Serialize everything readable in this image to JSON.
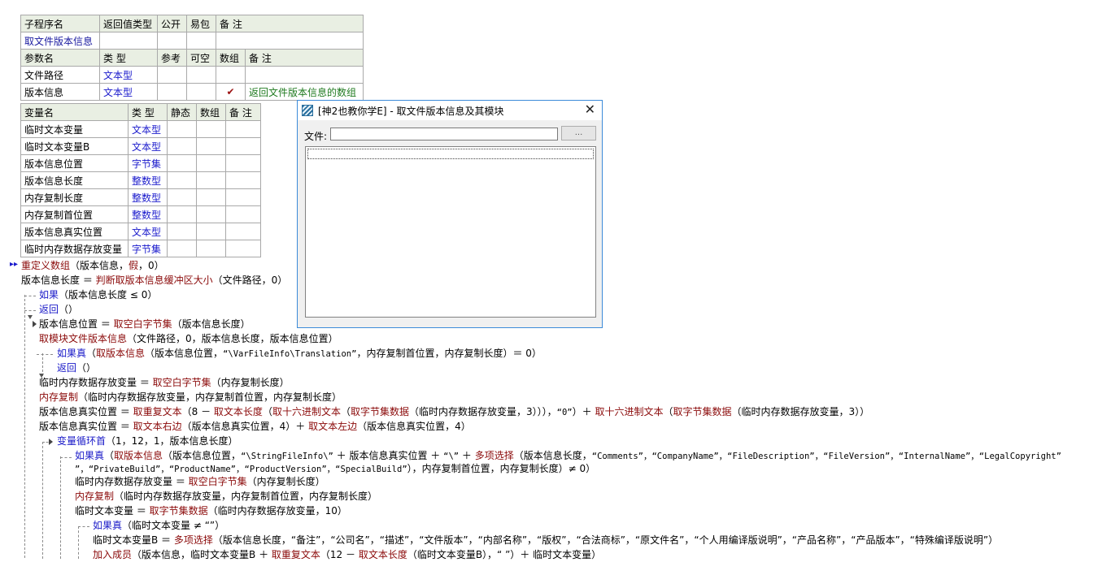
{
  "sub_table": {
    "headers": [
      "子程序名",
      "返回值类型",
      "公开",
      "易包",
      "备 注"
    ],
    "name": "取文件版本信息",
    "param_headers": [
      "参数名",
      "类 型",
      "参考",
      "可空",
      "数组",
      "备 注"
    ],
    "params": [
      {
        "name": "文件路径",
        "type": "文本型",
        "ref": "",
        "nullable": "",
        "array": "",
        "note": ""
      },
      {
        "name": "版本信息",
        "type": "文本型",
        "ref": "",
        "nullable": "",
        "array": "✔",
        "note": "返回文件版本信息的数组"
      }
    ]
  },
  "var_table": {
    "headers": [
      "变量名",
      "类 型",
      "静态",
      "数组",
      "备 注"
    ],
    "rows": [
      {
        "name": "临时文本变量",
        "type": "文本型"
      },
      {
        "name": "临时文本变量B",
        "type": "文本型"
      },
      {
        "name": "版本信息位置",
        "type": "字节集"
      },
      {
        "name": "版本信息长度",
        "type": "整数型"
      },
      {
        "name": "内存复制长度",
        "type": "整数型"
      },
      {
        "name": "内存复制首位置",
        "type": "整数型"
      },
      {
        "name": "版本信息真实位置",
        "type": "文本型"
      },
      {
        "name": "临时内存数据存放变量",
        "type": "字节集"
      }
    ]
  },
  "code": {
    "l1_cmd": "重定义数组",
    "l1_args": "（版本信息，",
    "l1_false": "假",
    "l1_end": "，0）",
    "l2_a": "版本信息长度 ＝ ",
    "l2_cmd": "判断取版本信息缓冲区大小",
    "l2_b": "（文件路径，0）",
    "l3_kw": "如果",
    "l3_b": "（版本信息长度 ≤ 0）",
    "l4_kw": "返回",
    "l4_b": "（）",
    "l5_a": "版本信息位置 ＝ ",
    "l5_cmd": "取空白字节集",
    "l5_b": "（版本信息长度）",
    "l6_cmd": "取模块文件版本信息",
    "l6_b": "（文件路径，0，版本信息长度，版本信息位置）",
    "l7_kw": "如果真",
    "l7_b": "（",
    "l7_cmd": "取版本信息",
    "l7_c": "（版本信息位置，",
    "l7_str": "“\\VarFileInfo\\Translation”",
    "l7_d": "，内存复制首位置，内存复制长度）＝ 0）",
    "l8_kw": "返回",
    "l8_b": "（）",
    "l9_a": "临时内存数据存放变量 ＝ ",
    "l9_cmd": "取空白字节集",
    "l9_b": "（内存复制长度）",
    "l10_cmd": "内存复制",
    "l10_b": "（临时内存数据存放变量，内存复制首位置，内存复制长度）",
    "l11_a": "版本信息真实位置 ＝ ",
    "l11_cmd1": "取重复文本",
    "l11_b": "（8 － ",
    "l11_cmd2": "取文本长度",
    "l11_c": "（",
    "l11_cmd3": "取十六进制文本",
    "l11_d": "（",
    "l11_cmd4": "取字节集数据",
    "l11_e": "（临时内存数据存放变量，3））），",
    "l11_str": "“0”",
    "l11_f": "）＋ ",
    "l11_cmd5": "取十六进制文本",
    "l11_g": "（",
    "l11_cmd6": "取字节集数据",
    "l11_h": "（临时内存数据存放变量，3））",
    "l12_a": "版本信息真实位置 ＝ ",
    "l12_cmd1": "取文本右边",
    "l12_b": "（版本信息真实位置，4）＋ ",
    "l12_cmd2": "取文本左边",
    "l12_c": "（版本信息真实位置，4）",
    "l13_kw": "变量循环首",
    "l13_b": "（1，12，1，版本信息长度）",
    "l14_kw": "如果真",
    "l14_b": "（",
    "l14_cmd": "取版本信息",
    "l14_c": "（版本信息位置，",
    "l14_str1": "“\\StringFileInfo\\”",
    "l14_d": " ＋ 版本信息真实位置 ＋ ",
    "l14_str2": "“\\”",
    "l14_e": " ＋ ",
    "l14_cmd2": "多项选择",
    "l14_f": "（版本信息长度，",
    "l14_str3": "“Comments”，“CompanyName”，“FileDescription”，“FileVersion”，“InternalName”，“LegalCopyright”",
    "l15_str": "”，“PrivateBuild”，“ProductName”，“ProductVersion”，“SpecialBuild”",
    "l15_b": "），内存复制首位置，内存复制长度）≠ 0）",
    "l16_a": "临时内存数据存放变量 ＝ ",
    "l16_cmd": "取空白字节集",
    "l16_b": "（内存复制长度）",
    "l17_cmd": "内存复制",
    "l17_b": "（临时内存数据存放变量，内存复制首位置，内存复制长度）",
    "l18_a": "临时文本变量 ＝ ",
    "l18_cmd": "取字节集数据",
    "l18_b": "（临时内存数据存放变量，10）",
    "l19_kw": "如果真",
    "l19_b": "（临时文本变量 ≠ “”）",
    "l20_a": "临时文本变量B ＝ ",
    "l20_cmd": "多项选择",
    "l20_b": "（版本信息长度，“备注”，“公司名”，“描述”，“文件版本”，“内部名称”，“版权”，“合法商标”，“原文件名”，“个人用编译版说明”，“产品名称”，“产品版本”，“特殊编译版说明”）",
    "l21_cmd": "加入成员",
    "l21_b": "（版本信息，临时文本变量B ＋ ",
    "l21_cmd2": "取重复文本",
    "l21_c": "（12 － ",
    "l21_cmd3": "取文本长度",
    "l21_d": "（临时文本变量B），“ ”）＋ 临时文本变量）"
  },
  "dialog": {
    "title": "[神2也教你学E] - 取文件版本信息及其模块",
    "file_label": "文件:",
    "file_value": "",
    "browse_label": "...",
    "close_symbol": "✕"
  }
}
